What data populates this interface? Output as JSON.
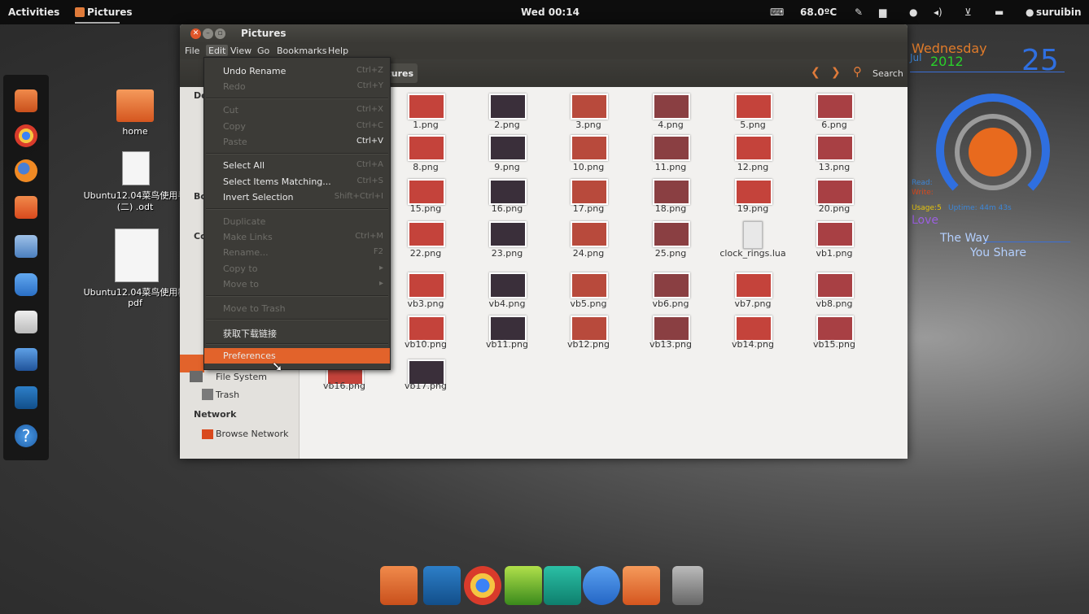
{
  "top_panel": {
    "activities": "Activities",
    "app": "Pictures",
    "clock": "Wed 00:14",
    "temperature": "68.0ºC",
    "user": "suruibin"
  },
  "desktop_icons": [
    {
      "label": "home"
    },
    {
      "label": "Ubuntu12.04菜鸟使用手",
      "label2": "(二) .odt"
    },
    {
      "label": "Ubuntu12.04菜鸟使用教",
      "label2": "pdf"
    }
  ],
  "conky": {
    "day": "Wednesday",
    "month": "Jul",
    "year": "2012",
    "date": "25",
    "read_label": "Read:",
    "write_label": "Write:",
    "usage_label": "Usage:5",
    "uptime": "Uptime: 44m 43s",
    "love": "Love",
    "the_way": "The Way",
    "you_share": "You Share"
  },
  "window": {
    "title": "Pictures",
    "menus": [
      "File",
      "Edit",
      "View",
      "Go",
      "Bookmarks",
      "Help"
    ],
    "breadcrumb": "ctures",
    "search_label": "Search"
  },
  "edit_menu": {
    "items": [
      {
        "label": "Undo Rename",
        "accel": "Ctrl+Z",
        "enabled": true
      },
      {
        "label": "Redo",
        "accel": "Ctrl+Y",
        "enabled": false
      },
      {
        "label": "Cut",
        "accel": "Ctrl+X",
        "enabled": false
      },
      {
        "label": "Copy",
        "accel": "Ctrl+C",
        "enabled": false
      },
      {
        "label": "Paste",
        "accel": "Ctrl+V",
        "enabled": false
      },
      {
        "label": "Select All",
        "accel": "Ctrl+A",
        "enabled": true
      },
      {
        "label": "Select Items Matching...",
        "accel": "Ctrl+S",
        "enabled": true
      },
      {
        "label": "Invert Selection",
        "accel": "Shift+Ctrl+I",
        "enabled": true
      },
      {
        "label": "Duplicate",
        "accel": "",
        "enabled": false
      },
      {
        "label": "Make Links",
        "accel": "Ctrl+M",
        "enabled": false
      },
      {
        "label": "Rename...",
        "accel": "F2",
        "enabled": false
      },
      {
        "label": "Copy to",
        "accel": "",
        "enabled": false
      },
      {
        "label": "Move to",
        "accel": "",
        "enabled": false
      },
      {
        "label": "Move to Trash",
        "accel": "",
        "enabled": false
      },
      {
        "label": "获取下载链接",
        "accel": "",
        "enabled": true
      },
      {
        "label": "Preferences",
        "accel": "",
        "enabled": true
      }
    ]
  },
  "sidebar": {
    "head_devices": "De",
    "head_bookmarks": "Bo",
    "head_computer": "Co",
    "file_system": "File System",
    "trash": "Trash",
    "network_head": "Network",
    "browse_network": "Browse Network"
  },
  "files": [
    "1.png",
    "2.png",
    "3.png",
    "4.png",
    "5.png",
    "6.png",
    "8.png",
    "9.png",
    "10.png",
    "11.png",
    "12.png",
    "13.png",
    "15.png",
    "16.png",
    "17.png",
    "18.png",
    "19.png",
    "20.png",
    "22.png",
    "23.png",
    "24.png",
    "25.png",
    "clock_rings.lua",
    "vb1.png",
    "vb3.png",
    "vb4.png",
    "vb5.png",
    "vb6.png",
    "vb7.png",
    "vb8.png",
    "vb10.png",
    "vb11.png",
    "vb12.png",
    "vb13.png",
    "vb14.png",
    "vb15.png",
    "vb16.png",
    "vb17.png"
  ]
}
